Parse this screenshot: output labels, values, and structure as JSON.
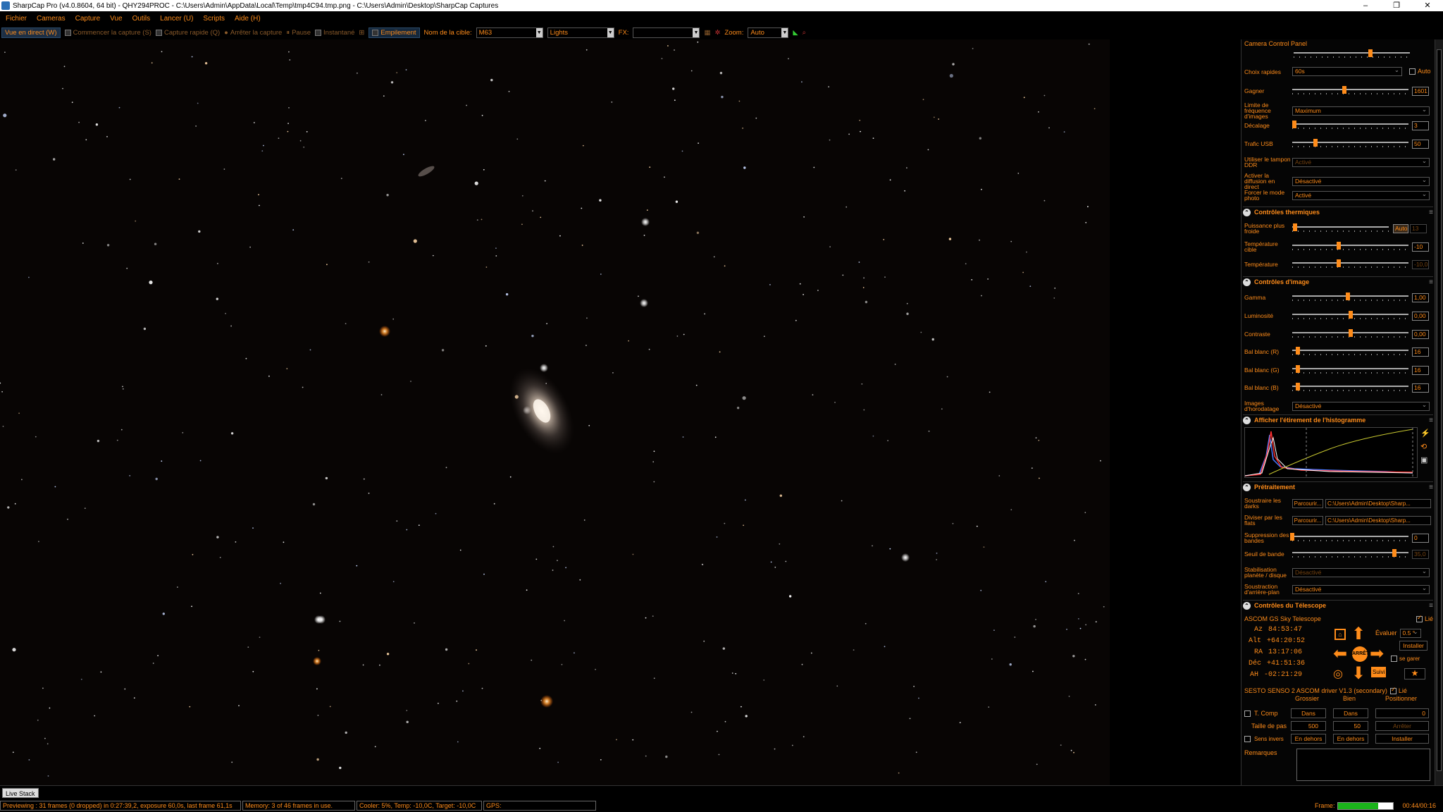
{
  "window": {
    "title": "SharpCap Pro (v4.0.8604, 64 bit) - QHY294PROC - C:\\Users\\Admin\\AppData\\Local\\Temp\\tmp4C94.tmp.png - C:\\Users\\Admin\\Desktop\\SharpCap Captures",
    "min": "–",
    "max": "❐",
    "close": "✕"
  },
  "menu": [
    "Fichier",
    "Cameras",
    "Capture",
    "Vue",
    "Outils",
    "Lancer (U)",
    "Scripts",
    "Aide (H)"
  ],
  "toolbar": {
    "live": "Vue en direct (W)",
    "start": "Commencer la capture (S)",
    "quick": "Capture rapide (Q)",
    "stop": "Arrêter la capture",
    "pause": "Pause",
    "snapshot": "Instantané",
    "stack": "Empilement",
    "target_label": "Nom de la cible:",
    "target_value": "M63",
    "frame_type": "Lights",
    "fx_label": "FX:",
    "fx_value": "",
    "zoom_label": "Zoom:",
    "zoom_value": "Auto"
  },
  "panel": {
    "title": "Camera Control Panel",
    "rows": {
      "quick_label": "Choix rapides",
      "quick_value": "60s",
      "auto_label": "Auto",
      "gain_label": "Gagner",
      "gain_value": "1601",
      "gain_level": 0.45,
      "fps_label": "Limite de fréquence d'images",
      "fps_value": "Maximum",
      "offset_label": "Décalage",
      "offset_value": "3",
      "offset_level": 0.02,
      "usb_label": "Trafic USB",
      "usb_value": "50",
      "usb_level": 0.2,
      "ddr_label": "Utiliser le tampon DDR",
      "ddr_value": "Activé",
      "stream_label": "Activer la diffusion en direct",
      "stream_value": "Désactivé",
      "photo_label": "Forcer le mode photo",
      "photo_value": "Activé"
    },
    "thermal": {
      "header": "Contrôles thermiques",
      "cooler_label": "Puissance plus froide",
      "cooler_auto": "Auto",
      "cooler_value": "13",
      "cooler_level": 0.03,
      "target_label": "Température cible",
      "target_value": "-10",
      "target_level": 0.4,
      "temp_label": "Température",
      "temp_value": "-10,0",
      "temp_level": 0.4
    },
    "image": {
      "header": "Contrôles d'image",
      "gamma_label": "Gamma",
      "gamma_value": "1,00",
      "gamma_level": 0.48,
      "lum_label": "Luminosité",
      "lum_value": "0,00",
      "lum_level": 0.5,
      "contrast_label": "Contraste",
      "contrast_value": "0,00",
      "contrast_level": 0.5,
      "wbr_label": "Bal blanc (R)",
      "wbr_value": "16",
      "wbr_level": 0.05,
      "wbg_label": "Bal blanc (G)",
      "wbg_value": "16",
      "wbg_level": 0.05,
      "wbb_label": "Bal blanc (B)",
      "wbb_value": "16",
      "wbb_level": 0.05,
      "ts_label": "Images d'horodatage",
      "ts_value": "Désactivé"
    },
    "histogram": {
      "header": "Afficher l'étirement de l'histogramme"
    },
    "preprocessing": {
      "header": "Prétraitement",
      "darks_label": "Soustraire les darks",
      "darks_browse": "Parcourir...",
      "darks_path": "C:\\Users\\Admin\\Desktop\\Sharp...",
      "flats_label": "Diviser par les flats",
      "flats_browse": "Parcourir...",
      "flats_path": "C:\\Users\\Admin\\Desktop\\Sharp...",
      "band_label": "Suppression des bandes",
      "band_value": "0",
      "band_level": 0.0,
      "thresh_label": "Seuil de bande",
      "thresh_value": "35,0",
      "thresh_level": 0.88,
      "stab_label": "Stabilisation planète / disque",
      "stab_value": "Désactivé",
      "bg_label": "Soustraction d'arrière-plan",
      "bg_value": "Désactivé"
    },
    "telescope": {
      "header": "Contrôles du Télescope",
      "name": "ASCOM GS Sky Telescope",
      "linked": "Lié",
      "az_label": "Az",
      "az": "84:53:47",
      "alt_label": "Alt",
      "alt": "+64:20:52",
      "ra_label": "RA",
      "ra": "13:17:06",
      "dec_label": "Déc",
      "dec": "+41:51:36",
      "ah_label": "AH",
      "ah": "-02:21:29",
      "rate_label": "Évaluer",
      "rate": "0.5 °",
      "install": "Installer",
      "park": "se garer",
      "follow": "Suivi",
      "center": "ARRÊT"
    },
    "focuser": {
      "name": "SESTO SENSO 2 ASCOM driver V1.3 (secondary)",
      "linked": "Lié",
      "coarse": "Grossier",
      "fine": "Bien",
      "position": "Positionner",
      "tcomp": "T. Comp",
      "in1": "Dans",
      "in2": "Dans",
      "pos_value": "0",
      "step_label": "Taille de pas",
      "step1": "500",
      "step2": "50",
      "stop": "Arrêter",
      "reverse": "Sens invers",
      "out1": "En dehors",
      "out2": "En dehors",
      "install": "Installer"
    },
    "remarks_label": "Remarques"
  },
  "bottom": {
    "tab": "Live Stack"
  },
  "status": {
    "preview": "Previewing : 31 frames (0 dropped) in 0:27:39,2, exposure 60,0s, last frame 61,1s",
    "memory": "Memory: 3 of 46 frames in use.",
    "cooler": "Cooler: 5%, Temp: -10,0C, Target: -10,0C",
    "gps": "GPS:",
    "frame_label": "Frame:",
    "frame_progress": 0.73,
    "time": "00:44/00:16"
  },
  "colors": {
    "accent": "#ff8c1a",
    "bg": "#000000",
    "progress": "#1bb31b"
  }
}
